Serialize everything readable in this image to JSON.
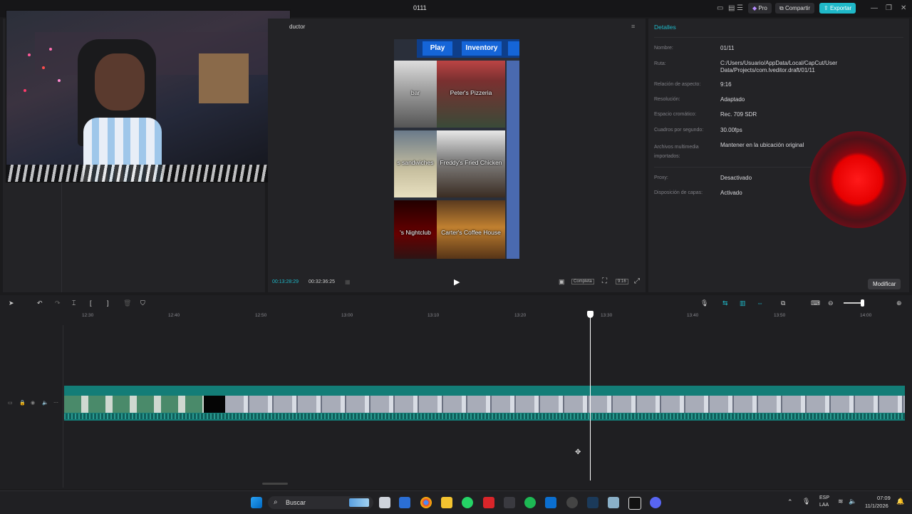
{
  "window": {
    "title": "0111",
    "pro_label": "Pro",
    "share_label": "Compartir",
    "export_label": "Exportar"
  },
  "player": {
    "tab_label": "ductor",
    "current_time": "00:13:28:29",
    "total_time": "00:32:36:25",
    "full_label": "Completa",
    "ratio_label": "9:16"
  },
  "game": {
    "play": "Play",
    "inventory": "Inventory",
    "tiles": [
      {
        "label": "Peter's Pizzeria"
      },
      {
        "label": "Freddy's Fried Chicken"
      },
      {
        "label": "'s Nightclub"
      },
      {
        "label": "Carter's Coffee House"
      },
      {
        "label": "s sandwiches"
      },
      {
        "label": "bar"
      }
    ]
  },
  "details": {
    "heading": "Detalles",
    "rows": [
      {
        "label": "Nombre:",
        "value": "01/11"
      },
      {
        "label": "Ruta:",
        "value": "C:/Users/Usuario/AppData/Local/CapCut/User Data/Projects/com.lveditor.draft/01/11"
      },
      {
        "label": "Relación de aspecto:",
        "value": "9:16"
      },
      {
        "label": "Resolución:",
        "value": "Adaptado"
      },
      {
        "label": "Espacio cromático:",
        "value": "Rec. 709 SDR"
      },
      {
        "label": "Cuadros por segundo:",
        "value": "30.00fps"
      },
      {
        "label": "Archivos multimedia importados:",
        "value": "Mantener en la ubicación original"
      },
      {
        "label": "Proxy:",
        "value": "Desactivado"
      },
      {
        "label": "Disposición de capas:",
        "value": "Activado"
      }
    ],
    "modify_label": "Modificar"
  },
  "timeline": {
    "ticks": [
      "12:30",
      "12:40",
      "12:50",
      "13:00",
      "13:10",
      "13:20",
      "13:30",
      "13:40",
      "13:50",
      "14:00"
    ]
  },
  "taskbar": {
    "search_placeholder": "Buscar",
    "lang_top": "ESP",
    "lang_bottom": "LAA",
    "time": "07:09",
    "date": "11/1/2026"
  },
  "colors": {
    "accent": "#1fb8c8",
    "clip": "#137d77",
    "record": "#e60000"
  }
}
